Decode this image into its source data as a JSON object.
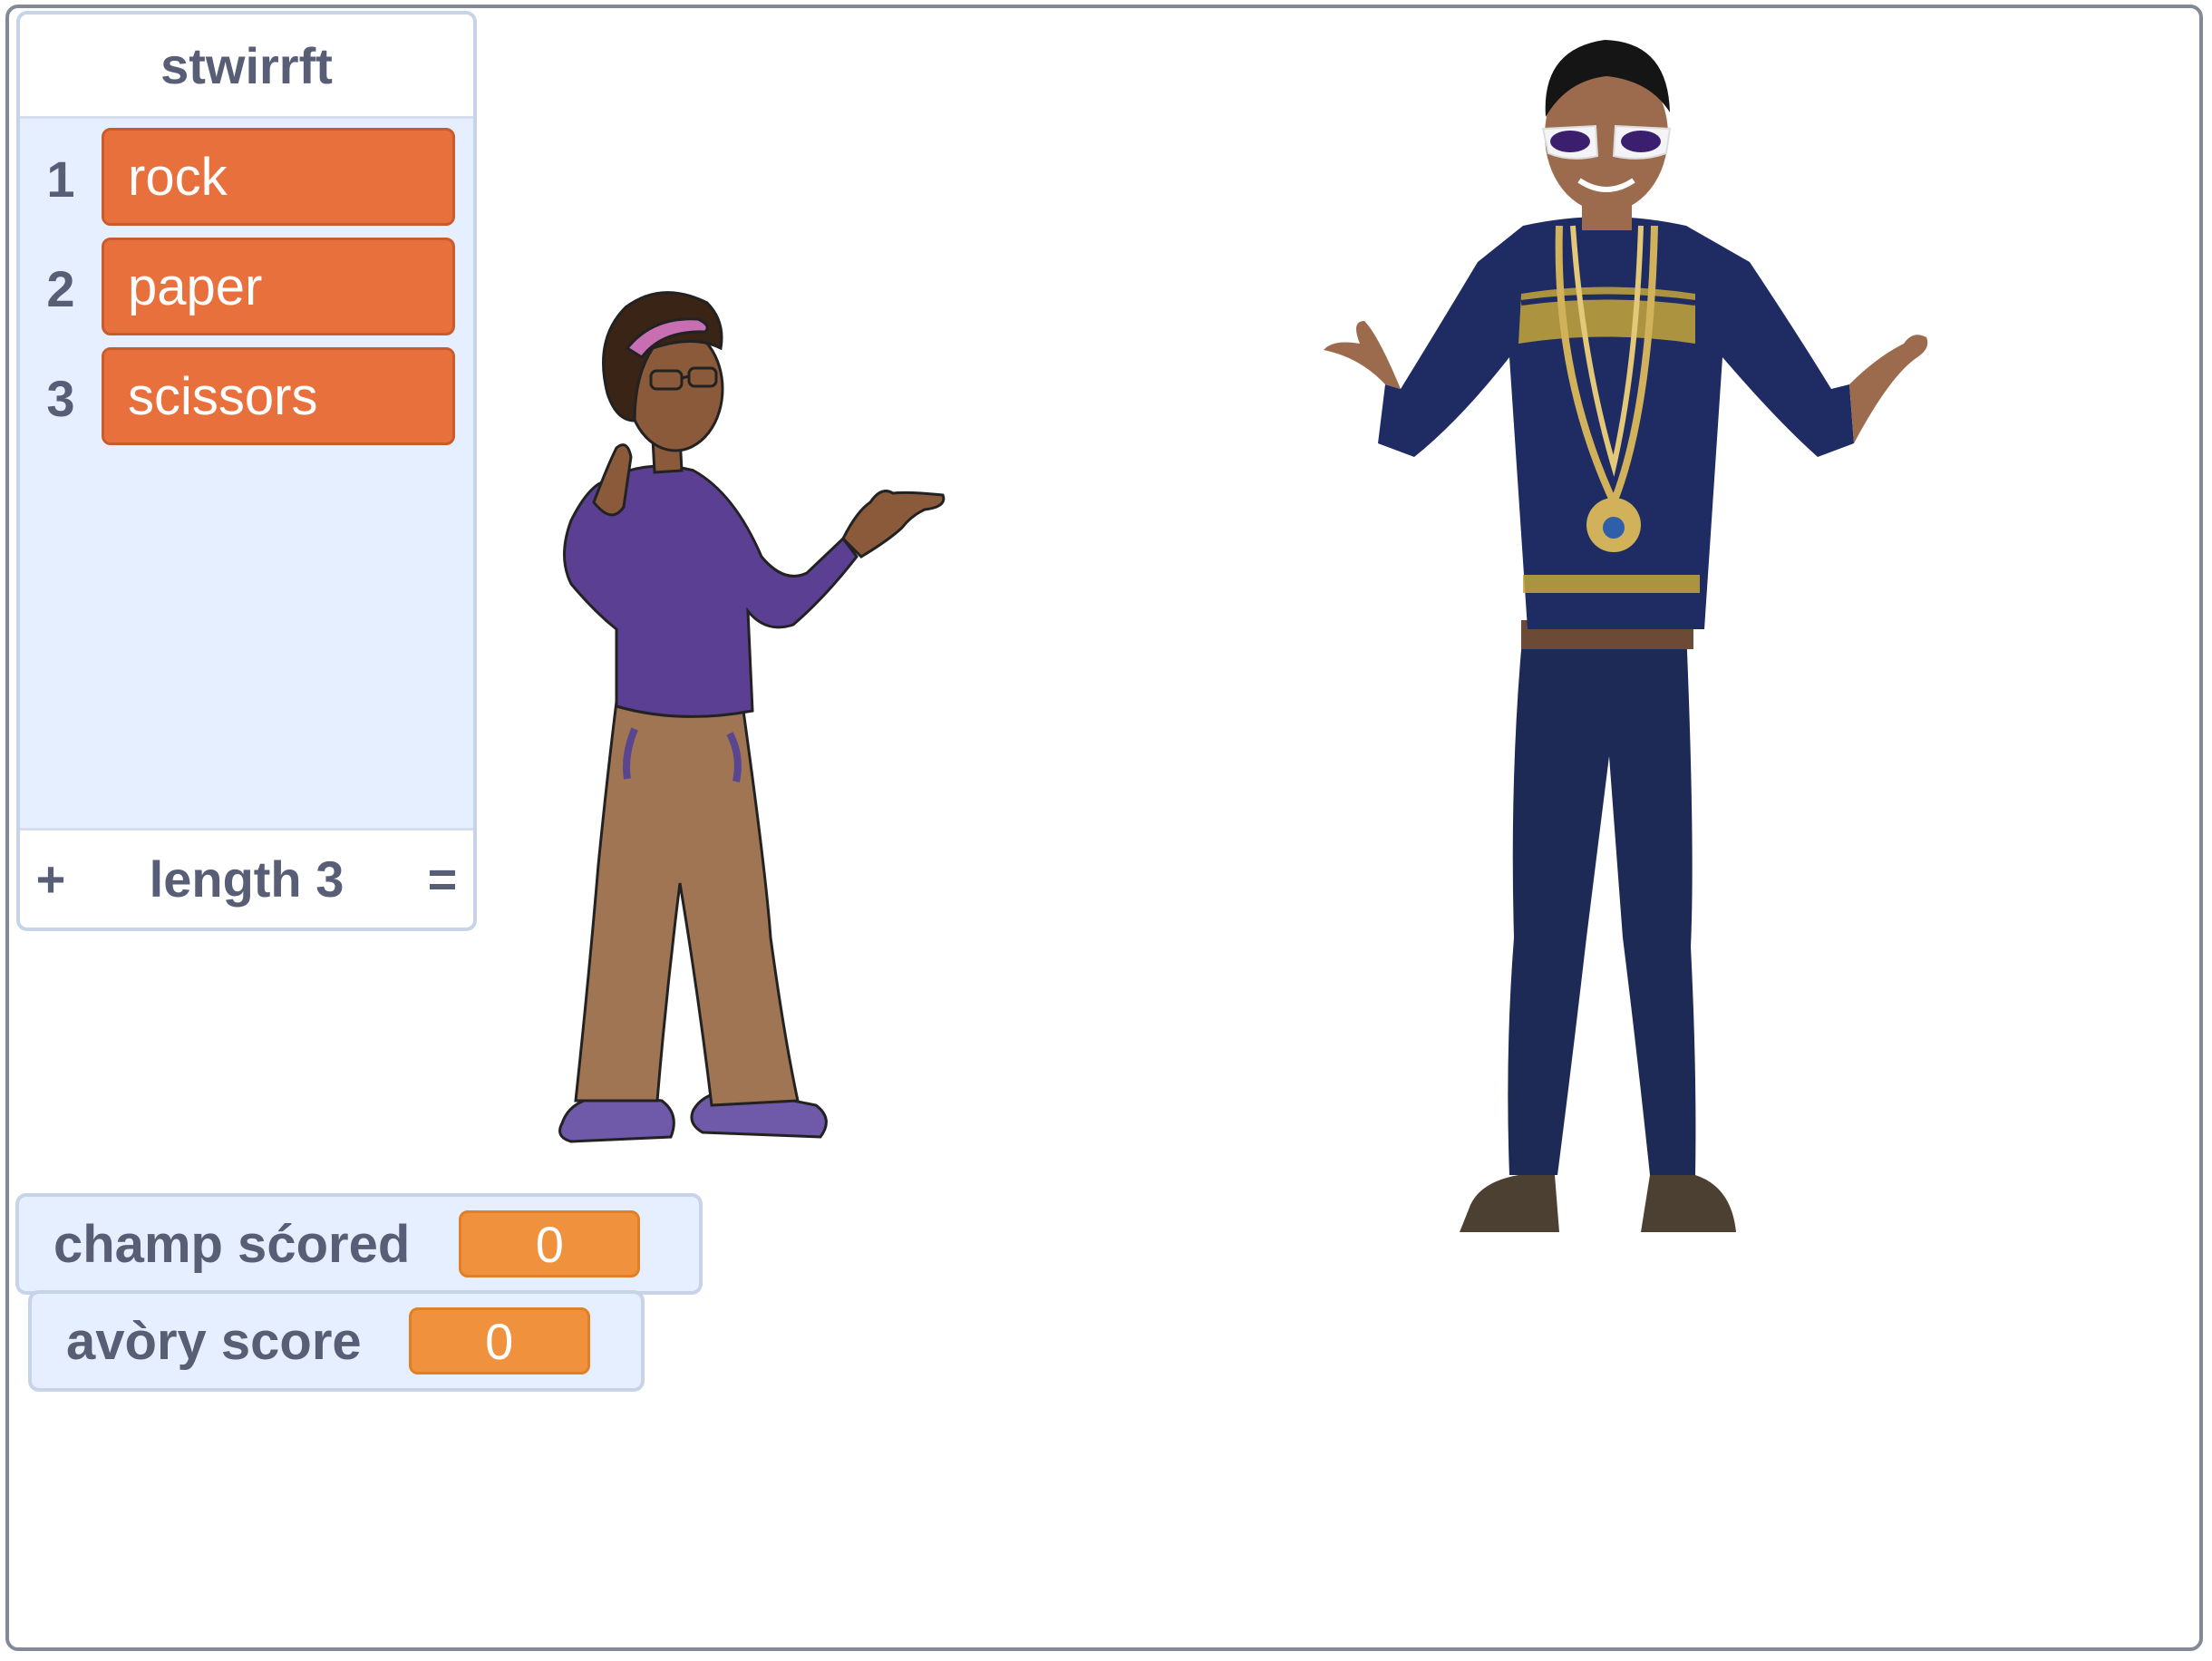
{
  "list": {
    "title": "stwirrft",
    "items": [
      {
        "index": "1",
        "value": "rock"
      },
      {
        "index": "2",
        "value": "paper"
      },
      {
        "index": "3",
        "value": "scissors"
      }
    ],
    "footer": {
      "add": "+",
      "length": "length 3",
      "resize": "="
    }
  },
  "variables": [
    {
      "label": "champ sćored",
      "value": "0"
    },
    {
      "label": "avòry score",
      "value": "0"
    }
  ],
  "colors": {
    "list_item": "#e8703d",
    "variable_value": "#f0923d",
    "monitor_bg": "#e6efff",
    "monitor_text": "#575e75",
    "stage_border": "#828a98"
  },
  "sprites": {
    "left": "cartoon-girl-sprite",
    "right": "photo-boy-sprite"
  }
}
